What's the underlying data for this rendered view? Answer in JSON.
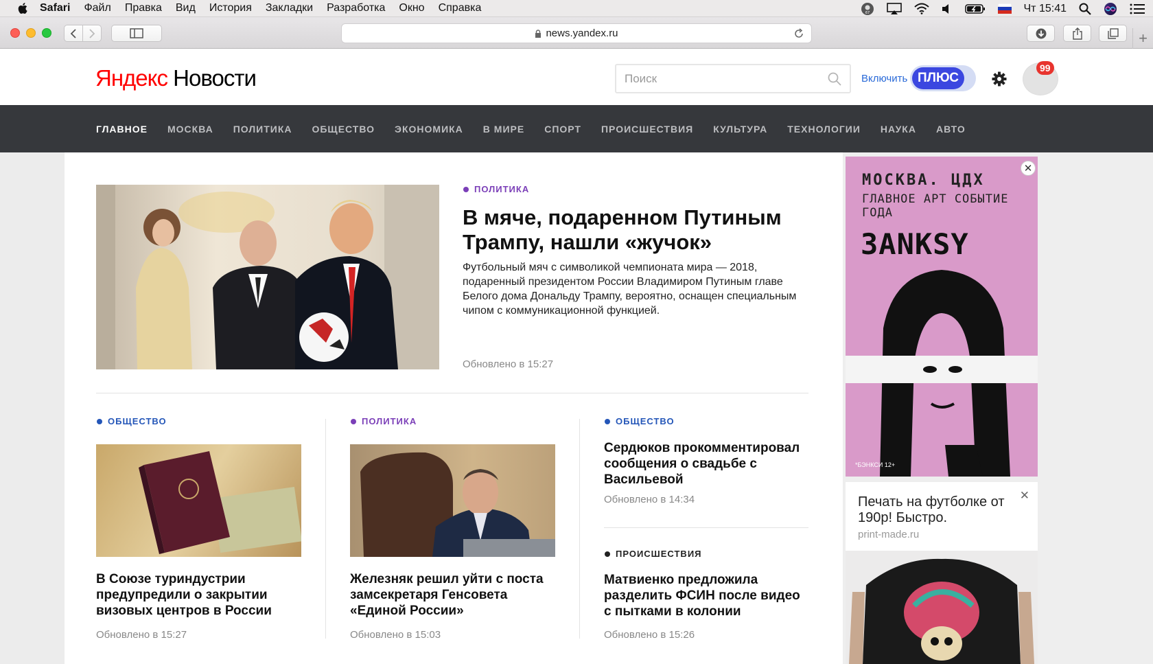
{
  "os_menu": {
    "app": "Safari",
    "items": [
      "Файл",
      "Правка",
      "Вид",
      "История",
      "Закладки",
      "Разработка",
      "Окно",
      "Справка"
    ],
    "clock": "Чт 15:41",
    "status_icons": [
      "user-67-icon",
      "airplay-icon",
      "wifi-icon",
      "volume-icon",
      "battery-icon",
      "flag-ru-icon",
      "spotlight-icon",
      "siri-icon",
      "notification-center-icon"
    ]
  },
  "browser": {
    "url": "news.yandex.ru",
    "traffic_lights": [
      "#fd5f57",
      "#febc2e",
      "#28c840"
    ]
  },
  "site": {
    "logo_brand": "Яндекс",
    "logo_service": "Новости",
    "search_placeholder": "Поиск",
    "plus_link": "Включить",
    "plus_label": "ПЛЮС",
    "notifications": "99"
  },
  "nav": [
    "ГЛАВНОЕ",
    "МОСКВА",
    "ПОЛИТИКА",
    "ОБЩЕСТВО",
    "ЭКОНОМИКА",
    "В МИРЕ",
    "СПОРТ",
    "ПРОИСШЕСТВИЯ",
    "КУЛЬТУРА",
    "ТЕХНОЛОГИИ",
    "НАУКА",
    "АВТО"
  ],
  "lead": {
    "category": "ПОЛИТИКА",
    "title": "В мяче, подаренном Путиным Трампу, нашли «жучок»",
    "text": "Футбольный мяч с символикой чемпионата мира — 2018, подаренный президентом России Владимиром Путиным главе Белого дома Дональду Трампу, вероятно, оснащен специальным чипом с коммуникационной функцией.",
    "updated": "Обновлено в 15:27"
  },
  "cards": [
    {
      "category": "ОБЩЕСТВО",
      "title": "В Союзе туриндустрии предупредили о закрытии визовых центров в России",
      "updated": "Обновлено в 15:27"
    },
    {
      "category": "ПОЛИТИКА",
      "title": "Железняк решил уйти с поста замсекретаря Генсовета «Единой России»",
      "updated": "Обновлено в 15:03"
    },
    {
      "category": "ОБЩЕСТВО",
      "title": "Сердюков прокомментировал сообщения о свадьбе с Васильевой",
      "updated": "Обновлено в 14:34"
    },
    {
      "category": "ПРОИСШЕСТВИЯ",
      "title": "Матвиенко предложила разделить ФСИН после видео с пытками в колонии",
      "updated": "Обновлено в 15:26"
    }
  ],
  "category_colors": {
    "ПОЛИТИКА": "#7b3fb8",
    "ОБЩЕСТВО": "#2456b8",
    "ПРОИСШЕСТВИЯ": "#222222"
  },
  "ads": {
    "banner_line1": "МОСКВА. ЦДХ",
    "banner_line2": "ГЛАВНОЕ АРТ СОБЫТИЕ ГОДА",
    "banner_name": "ЗАNКSY",
    "banner_note": "*БЭНКСИ 12+",
    "text_ad_title": "Печать на футболке от 190р! Быстро.",
    "text_ad_domain": "print-made.ru"
  }
}
